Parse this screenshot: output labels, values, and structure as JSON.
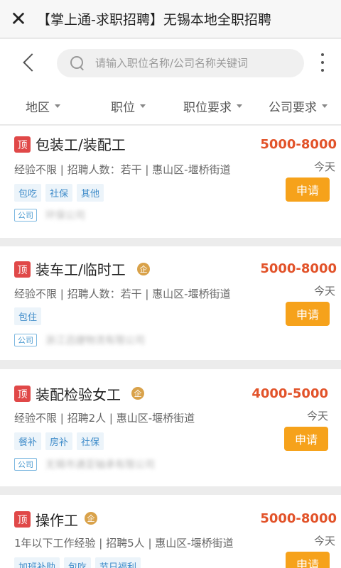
{
  "window": {
    "title": "【掌上通-求职招聘】无锡本地全职招聘",
    "close_icon": "close-icon"
  },
  "search": {
    "placeholder": "请输入职位名称/公司名称关键词",
    "value": ""
  },
  "filters": [
    {
      "label": "地区"
    },
    {
      "label": "职位"
    },
    {
      "label": "职位要求"
    },
    {
      "label": "公司要求"
    }
  ],
  "jobs": [
    {
      "pin": "顶",
      "title": "包装工/装配工",
      "verified": false,
      "salary": "5000-8000",
      "date": "今天",
      "meta": "经验不限 | 招聘人数：若干 | 惠山区-堰桥街道",
      "tags": [
        "包吃",
        "社保",
        "其他"
      ],
      "apply": "申请",
      "company_label": "公司",
      "company": "环保公司"
    },
    {
      "pin": "顶",
      "title": "装车工/临时工",
      "verified": true,
      "salary": "5000-8000",
      "date": "今天",
      "meta": "经验不限 | 招聘人数：若干 | 惠山区-堰桥街道",
      "tags": [
        "包住"
      ],
      "apply": "申请",
      "company_label": "公司",
      "company": "浙江迅捷物流有限公司"
    },
    {
      "pin": "顶",
      "title": "装配检验女工",
      "verified": true,
      "salary": "4000-5000",
      "date": "今天",
      "meta": "经验不限 | 招聘2人 | 惠山区-堰桥街道",
      "tags": [
        "餐补",
        "房补",
        "社保"
      ],
      "apply": "申请",
      "company_label": "公司",
      "company": "无锡市通亚轴承有限公司"
    },
    {
      "pin": "顶",
      "title": "操作工",
      "verified": true,
      "salary": "5000-8000",
      "date": "今天",
      "meta": "1年以下工作经验 | 招聘5人 | 惠山区-堰桥街道",
      "tags": [
        "加班补助",
        "包吃",
        "节日福利"
      ],
      "apply": "申请",
      "company_label": "公司",
      "company": ""
    }
  ],
  "verified_badge": "企",
  "colors": {
    "salary": "#e2532a",
    "apply_button": "#f6a21b",
    "pin_badge": "#e04848",
    "tag_text": "#3e8bc9"
  }
}
